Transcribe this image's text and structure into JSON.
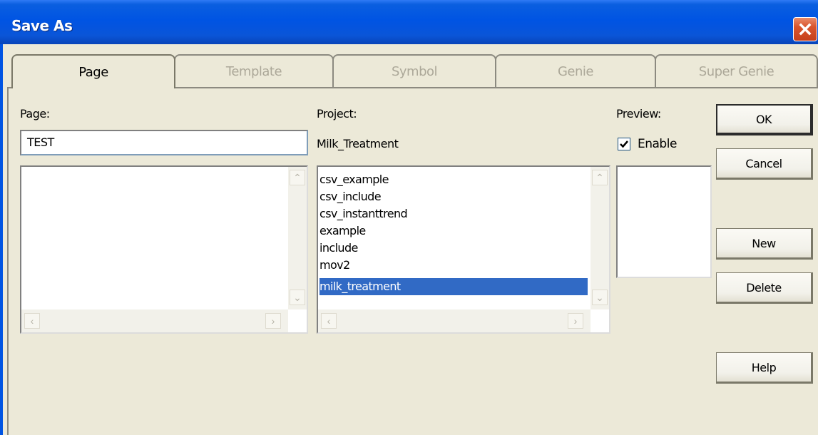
{
  "window": {
    "title": "Save As",
    "close_icon": "close-icon"
  },
  "tabs": [
    {
      "label": "Page",
      "active": true
    },
    {
      "label": "Template",
      "active": false
    },
    {
      "label": "Symbol",
      "active": false
    },
    {
      "label": "Genie",
      "active": false
    },
    {
      "label": "Super Genie",
      "active": false
    }
  ],
  "page_section": {
    "label": "Page:",
    "input_value": "TEST"
  },
  "project_section": {
    "label": "Project:",
    "current_project": "Milk_Treatment",
    "items": [
      "csv_example",
      "csv_include",
      "csv_instanttrend",
      "example",
      "include",
      "mov2",
      "milk_treatment"
    ],
    "selected_index": 6
  },
  "preview_section": {
    "label": "Preview:",
    "enable_label": "Enable",
    "enabled": true
  },
  "buttons": {
    "ok": "OK",
    "cancel": "Cancel",
    "new": "New",
    "delete": "Delete",
    "help": "Help"
  },
  "colors": {
    "title_bar": "#0054e3",
    "selection": "#316ac5",
    "dialog_bg": "#ece9d8",
    "close_button": "#d9542c"
  }
}
